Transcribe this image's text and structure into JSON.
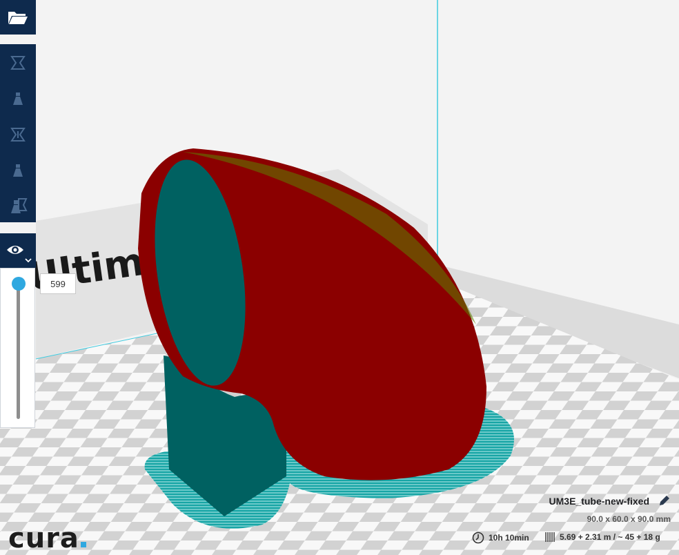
{
  "app": {
    "logo": "cura"
  },
  "layer_view": {
    "current_layer": "599",
    "slider_position": 1.0
  },
  "job": {
    "name": "UM3E_tube-new-fixed",
    "dimensions": "90.0 x 60.0 x 90.0 mm",
    "print_time": "10h 10min",
    "material": "5.69 + 2.31 m / ~ 45 + 18 g"
  },
  "toolbar": {
    "icons": [
      "folder-open-icon",
      "move-icon",
      "scale-icon",
      "rotate-icon",
      "mirror-icon",
      "per-model-settings-icon",
      "view-mode-icon"
    ]
  },
  "scene": {
    "backplate_text": "Ultim",
    "colors": {
      "wall_outer": "#8b0000",
      "support": "#006060",
      "skirt": "#1aa7a7",
      "grid_dark": "#d4d4d4",
      "grid_light": "#ffffff",
      "accent": "#2fa8e0"
    }
  }
}
